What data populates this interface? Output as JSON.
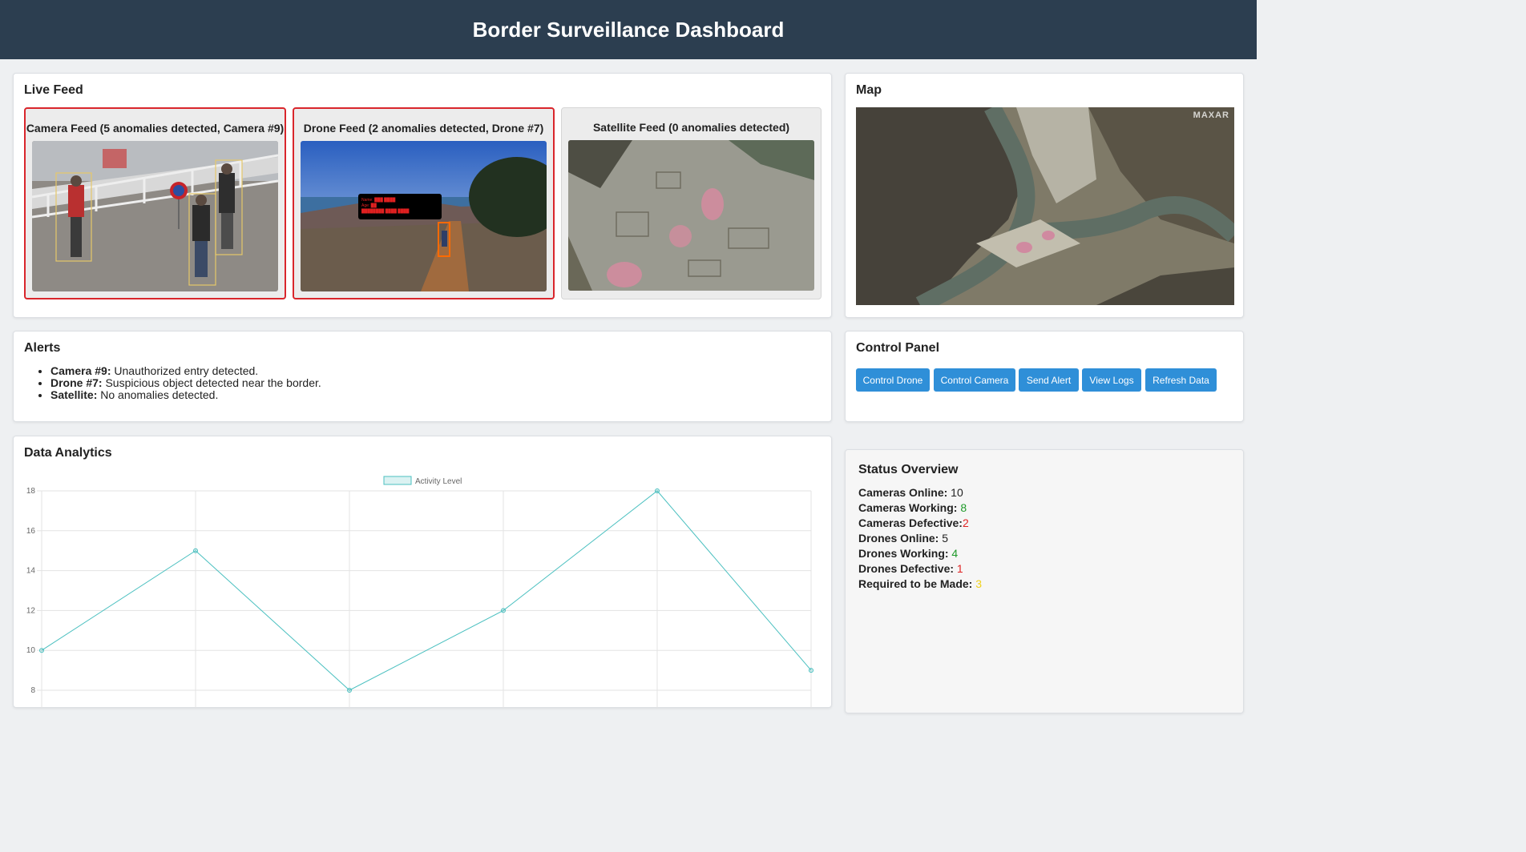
{
  "header": {
    "title": "Border Surveillance Dashboard"
  },
  "live_feed": {
    "title": "Live Feed",
    "feeds": [
      {
        "title": "Camera Feed (5 anomalies detected, Camera #9)"
      },
      {
        "title": "Drone Feed (2 anomalies detected, Drone #7)"
      },
      {
        "title": "Satellite Feed (0 anomalies detected)"
      }
    ]
  },
  "map": {
    "title": "Map",
    "watermark": "MAXAR"
  },
  "alerts": {
    "title": "Alerts",
    "items": [
      {
        "source": "Camera #9:",
        "text": " Unauthorized entry detected."
      },
      {
        "source": "Drone #7:",
        "text": " Suspicious object detected near the border."
      },
      {
        "source": "Satellite:",
        "text": " No anomalies detected."
      }
    ]
  },
  "control_panel": {
    "title": "Control Panel",
    "buttons": [
      "Control Drone",
      "Control Camera",
      "Send Alert",
      "View Logs",
      "Refresh Data"
    ]
  },
  "analytics": {
    "title": "Data Analytics"
  },
  "status": {
    "title": "Status Overview",
    "rows": [
      {
        "label": "Cameras Online:",
        "value": " 10",
        "color": "#222222"
      },
      {
        "label": "Cameras Working:",
        "value": " 8",
        "color": "#1f9a2a"
      },
      {
        "label": "Cameras Defective:",
        "value": "2",
        "color": "#e02424"
      },
      {
        "label": "Drones Online:",
        "value": " 5",
        "color": "#222222"
      },
      {
        "label": "Drones Working:",
        "value": " 4",
        "color": "#1f9a2a"
      },
      {
        "label": "Drones Defective:",
        "value": " 1",
        "color": "#e02424"
      },
      {
        "label": "Required to be Made:",
        "value": " 3",
        "color": "#f1d21b"
      }
    ]
  },
  "chart_data": {
    "type": "line",
    "title": "",
    "legend": "Activity Level",
    "legend_position": "top",
    "x": [
      0,
      1,
      2,
      3,
      4,
      5
    ],
    "series": [
      {
        "name": "Activity Level",
        "values": [
          10,
          15,
          8,
          12,
          18,
          9
        ]
      }
    ],
    "yticks": [
      8,
      10,
      12,
      14,
      16,
      18
    ],
    "ylim": [
      8,
      18
    ],
    "grid": true,
    "color": "#4bc0c0"
  }
}
